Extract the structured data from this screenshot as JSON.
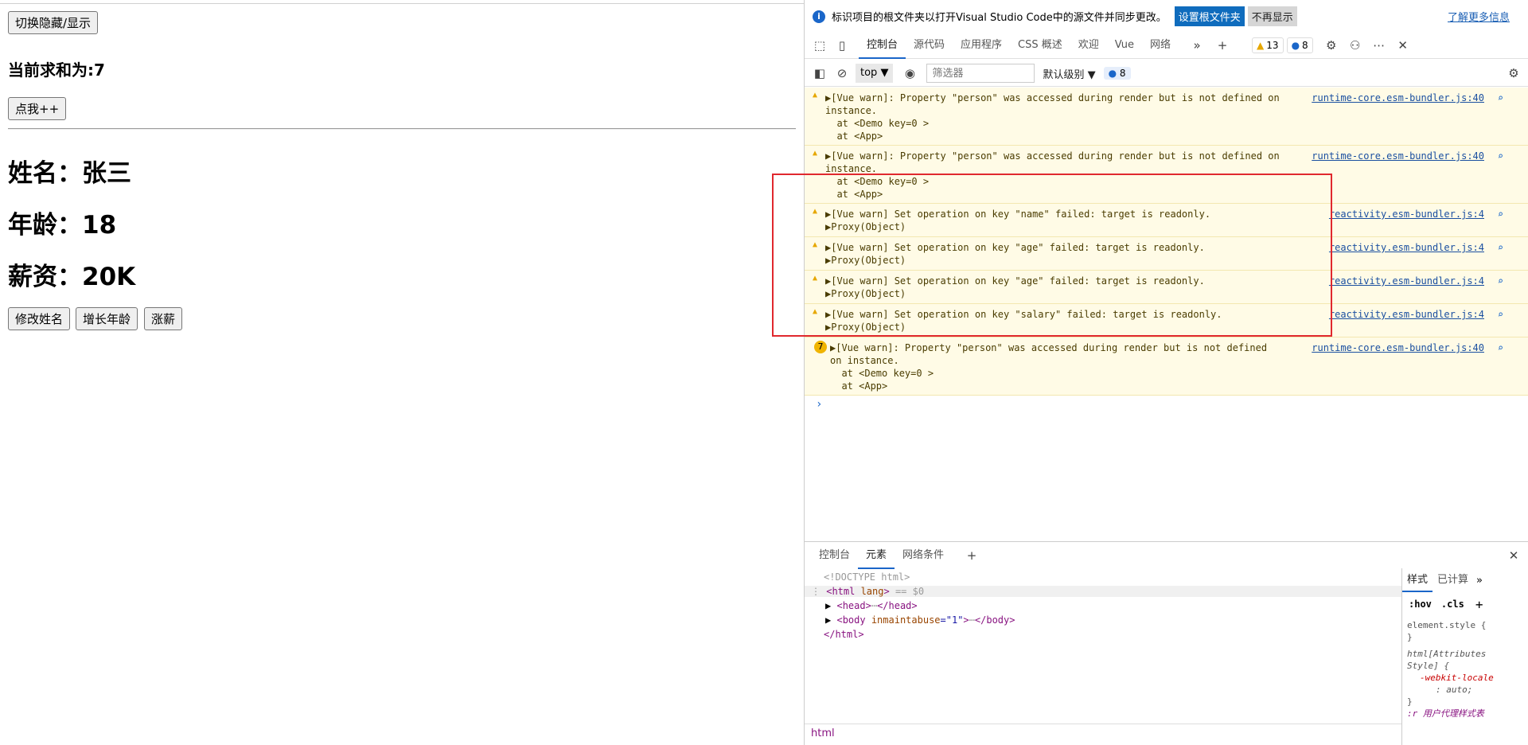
{
  "page": {
    "toggle_button": "切换隐藏/显示",
    "sum_text": "当前求和为:7",
    "click_button": "点我++",
    "name_line": "姓名：张三",
    "age_line": "年龄：18",
    "salary_line": "薪资：20K",
    "buttons": [
      "修改姓名",
      "增长年龄",
      "涨薪"
    ]
  },
  "devtools": {
    "infobar": {
      "text": "标识项目的根文件夹以打开Visual Studio Code中的源文件并同步更改。",
      "primary_button": "设置根文件夹",
      "secondary_button": "不再显示",
      "link": "了解更多信息"
    },
    "tabs": [
      "控制台",
      "源代码",
      "应用程序",
      "CSS 概述",
      "欢迎",
      "Vue",
      "网络"
    ],
    "active_tab": "控制台",
    "warn_count": "13",
    "msg_count": "8",
    "toolbar": {
      "context": "top",
      "filter_placeholder": "筛选器",
      "level": "默认级别",
      "count": "8"
    },
    "messages": [
      {
        "line1": "▶[Vue warn]: Property \"person\" was accessed during render but is not defined on",
        "line2": "instance.",
        "line3": "  at <Demo key=0 >",
        "line4": "  at <App>",
        "source": "runtime-core.esm-bundler.js:40"
      },
      {
        "line1": "▶[Vue warn]: Property \"person\" was accessed during render but is not defined on",
        "line2": "instance.",
        "line3": "  at <Demo key=0 >",
        "line4": "  at <App>",
        "source": "runtime-core.esm-bundler.js:40"
      },
      {
        "line1": "▶[Vue warn] Set operation on key \"name\" failed: target is readonly.",
        "line2": "▶Proxy(Object)",
        "source": "reactivity.esm-bundler.js:4"
      },
      {
        "line1": "▶[Vue warn] Set operation on key \"age\" failed: target is readonly.",
        "line2": "▶Proxy(Object)",
        "source": "reactivity.esm-bundler.js:4"
      },
      {
        "line1": "▶[Vue warn] Set operation on key \"age\" failed: target is readonly.",
        "line2": "▶Proxy(Object)",
        "source": "reactivity.esm-bundler.js:4"
      },
      {
        "line1": "▶[Vue warn] Set operation on key \"salary\" failed: target is readonly.",
        "line2": "▶Proxy(Object)",
        "source": "reactivity.esm-bundler.js:4"
      },
      {
        "count": "7",
        "line1": "▶[Vue warn]: Property \"person\" was accessed during render but is not defined",
        "line2": "on instance.",
        "line3": "  at <Demo key=0 >",
        "line4": "  at <App>",
        "source": "runtime-core.esm-bundler.js:40"
      }
    ],
    "drawer_tabs": [
      "控制台",
      "元素",
      "网络条件"
    ],
    "drawer_active": "元素",
    "elements": {
      "doctype": "<!DOCTYPE html>",
      "html_open": "<html",
      "html_attr": " lang",
      "html_close": ">",
      "html_sel": " == $0",
      "head": "<head>",
      "head_close": "</head>",
      "body_open": "<body",
      "body_attr": " inmaintabuse",
      "body_val": "=\"1\"",
      "body_end": ">",
      "body_close": "</body>",
      "html_end": "</html>",
      "ellipsis": "⋯"
    },
    "styles": {
      "tabs": [
        "样式",
        "已计算"
      ],
      "hov": ":hov",
      "cls": ".cls",
      "element_style": "element.style {",
      "close_brace": "}",
      "attr_style_1": "html[Attributes",
      "attr_style_2": "Style] {",
      "prop": "-webkit-locale",
      "prop_val": ": auto;",
      "agent": ":r  用户代理样式表"
    },
    "breadcrumb": "html"
  }
}
